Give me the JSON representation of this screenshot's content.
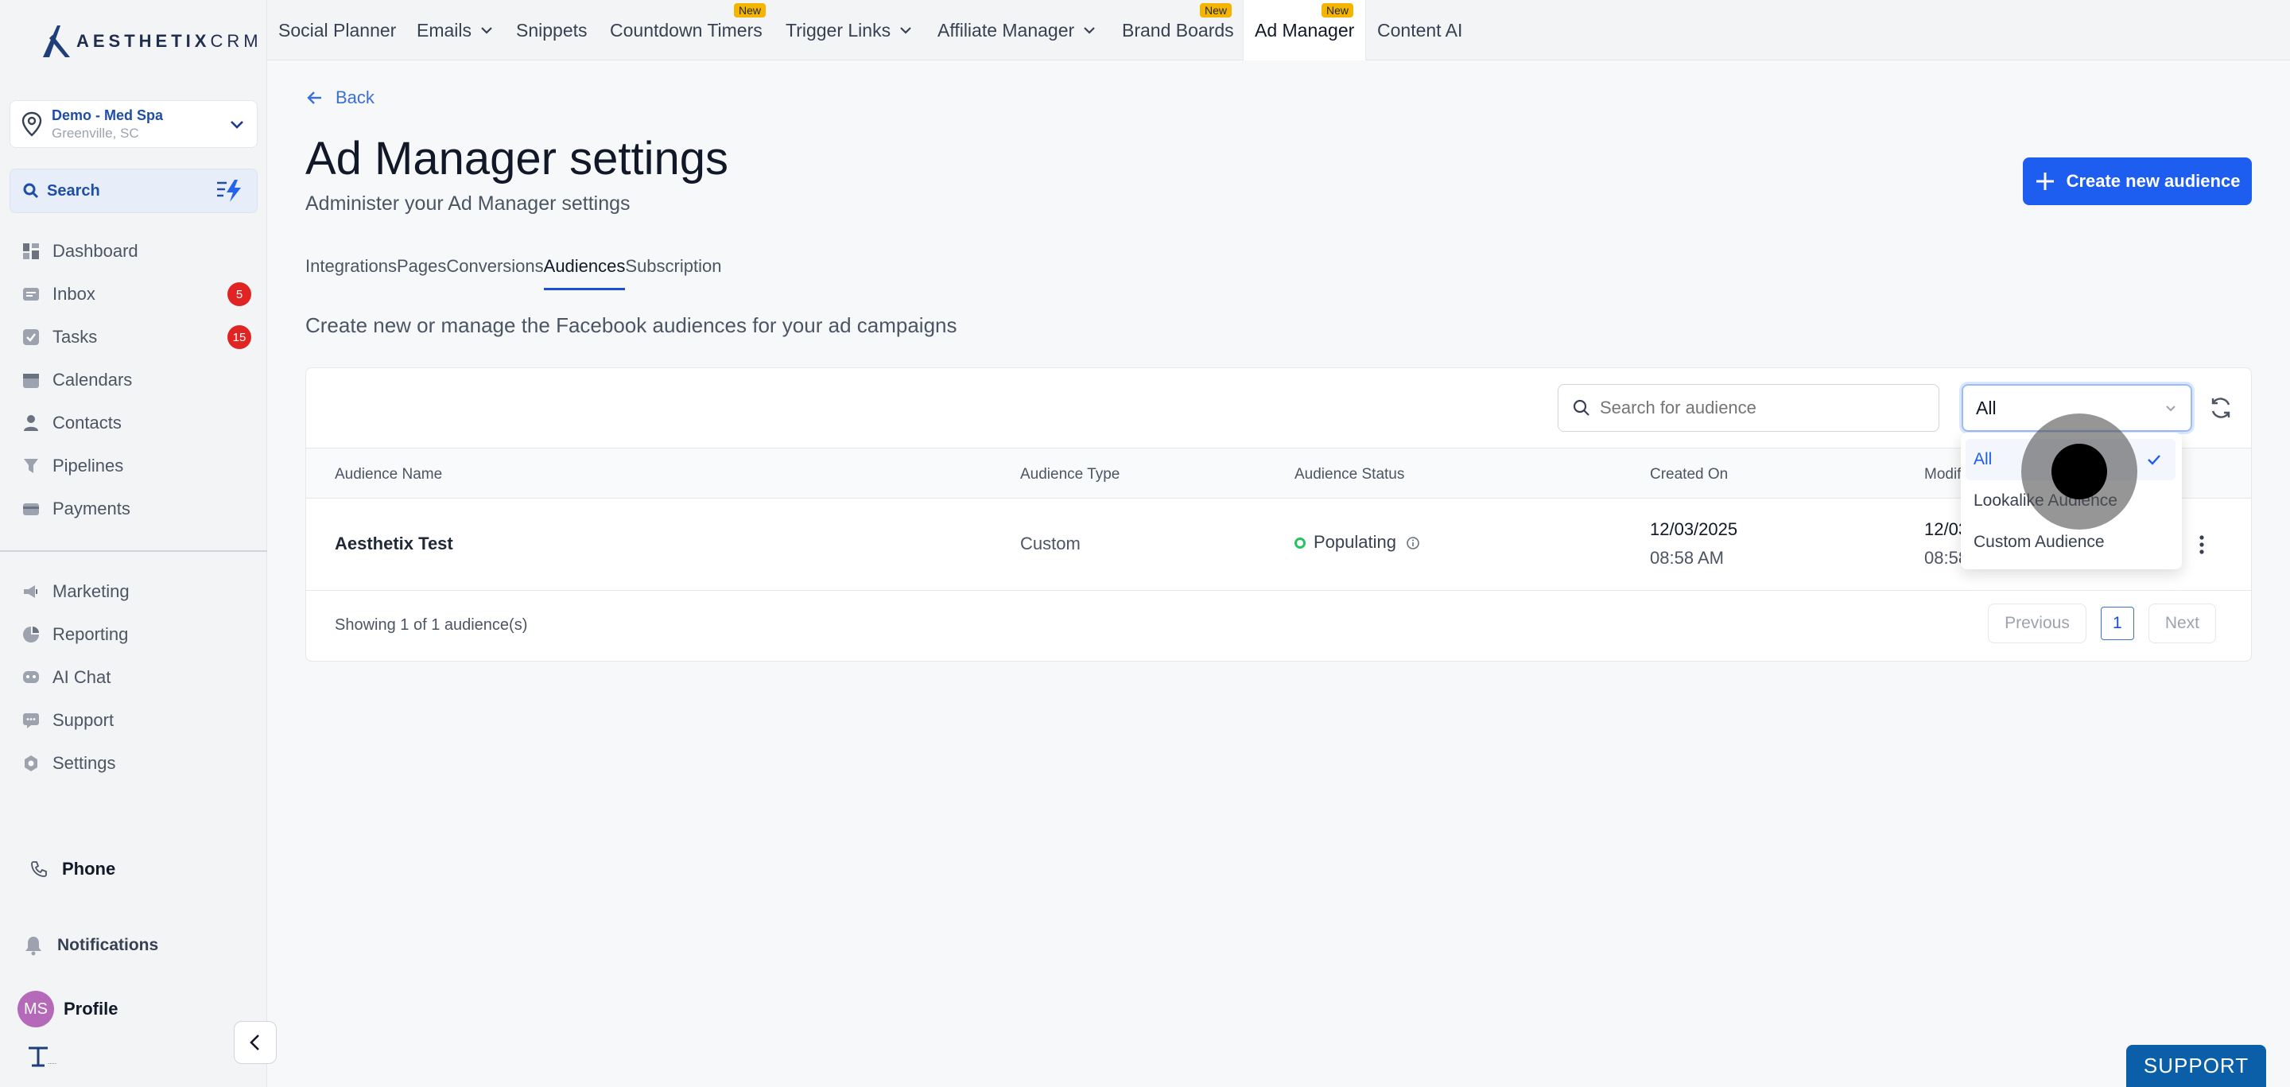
{
  "brand": {
    "name_bold": "AESTHETIX",
    "name_thin": "CRM"
  },
  "location": {
    "name": "Demo - Med Spa",
    "sub": "Greenville, SC"
  },
  "sidebar_search": {
    "label": "Search"
  },
  "sidebar": {
    "items": [
      {
        "label": "Dashboard",
        "icon": "dashboard-icon"
      },
      {
        "label": "Inbox",
        "icon": "inbox-icon",
        "badge": "5"
      },
      {
        "label": "Tasks",
        "icon": "tasks-icon",
        "badge": "15"
      },
      {
        "label": "Calendars",
        "icon": "calendar-icon"
      },
      {
        "label": "Contacts",
        "icon": "contacts-icon"
      },
      {
        "label": "Pipelines",
        "icon": "pipelines-icon"
      },
      {
        "label": "Payments",
        "icon": "payments-icon"
      },
      {
        "label": "Marketing",
        "icon": "marketing-icon"
      },
      {
        "label": "Reporting",
        "icon": "reporting-icon"
      },
      {
        "label": "AI Chat",
        "icon": "ai-chat-icon"
      },
      {
        "label": "Support",
        "icon": "support-icon"
      },
      {
        "label": "Settings",
        "icon": "settings-icon"
      }
    ],
    "phone": "Phone",
    "notifications": "Notifications",
    "profile": {
      "initials": "MS",
      "label": "Profile"
    }
  },
  "topnav": {
    "tabs": [
      {
        "label": "Social Planner"
      },
      {
        "label": "Emails"
      },
      {
        "label": "Snippets"
      },
      {
        "label": "Countdown Timers",
        "badge": "New"
      },
      {
        "label": "Trigger Links"
      },
      {
        "label": "Affiliate Manager"
      },
      {
        "label": "Brand Boards",
        "badge": "New"
      },
      {
        "label": "Ad Manager",
        "badge": "New"
      },
      {
        "label": "Content AI"
      }
    ]
  },
  "page": {
    "back": "Back",
    "title": "Ad Manager settings",
    "subtitle": "Administer your Ad Manager settings",
    "create_button": "Create new audience",
    "tabs": [
      "Integrations",
      "Pages",
      "Conversions",
      "Audiences",
      "Subscription"
    ],
    "active_tab": "Audiences",
    "description": "Create new or manage the Facebook audiences for your ad campaigns"
  },
  "audiences": {
    "search_placeholder": "Search for audience",
    "filter_value": "All",
    "filter_options": [
      "All",
      "Lookalike Audience",
      "Custom Audience"
    ],
    "columns": [
      "Audience Name",
      "Audience Type",
      "Audience Status",
      "Created On",
      "Modified On"
    ],
    "rows": [
      {
        "name": "Aesthetix Test",
        "type": "Custom",
        "status": "Populating",
        "created_date": "12/03/2025",
        "created_time": "08:58 AM",
        "modified_date": "12/03/2025",
        "modified_time": "08:58 AM"
      }
    ],
    "showing": "Showing 1 of 1 audience(s)",
    "pager": {
      "previous": "Previous",
      "page": "1",
      "next": "Next"
    }
  },
  "support_button": "SUPPORT",
  "colors": {
    "accent": "#1d5ef0",
    "badge_red": "#e02424",
    "new_badge": "#f5b400",
    "status_green": "#22c55e"
  }
}
